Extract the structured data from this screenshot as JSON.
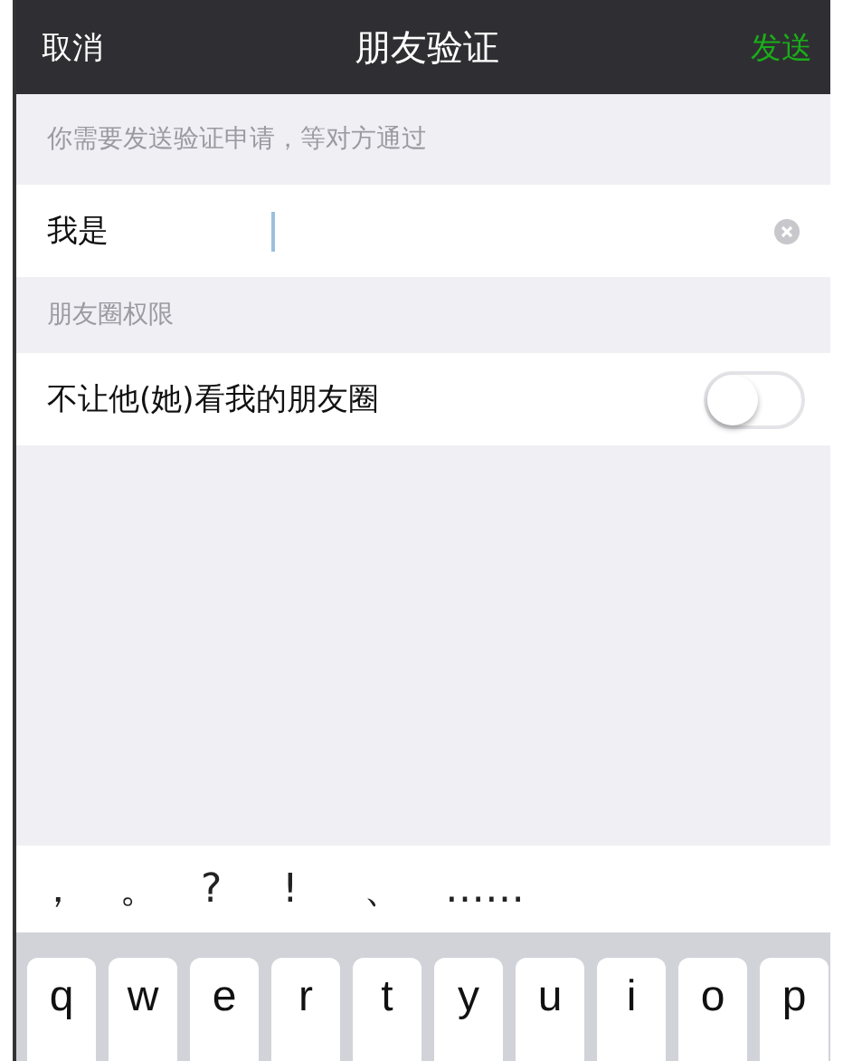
{
  "nav_bar": {
    "cancel": "取消",
    "title": "朋友验证",
    "send": "发送"
  },
  "hint": "你需要发送验证申请，等对方通过",
  "intro_field": {
    "label": "我是"
  },
  "section_label": "朋友圈权限",
  "settings": [
    {
      "label": "不让他(她)看我的朋友圈",
      "on": false
    }
  ],
  "suggestions": [
    "，",
    "。",
    "?",
    "!",
    "、",
    "……"
  ],
  "keys": [
    "q",
    "w",
    "e",
    "r",
    "t",
    "y",
    "u",
    "i",
    "o",
    "p"
  ]
}
